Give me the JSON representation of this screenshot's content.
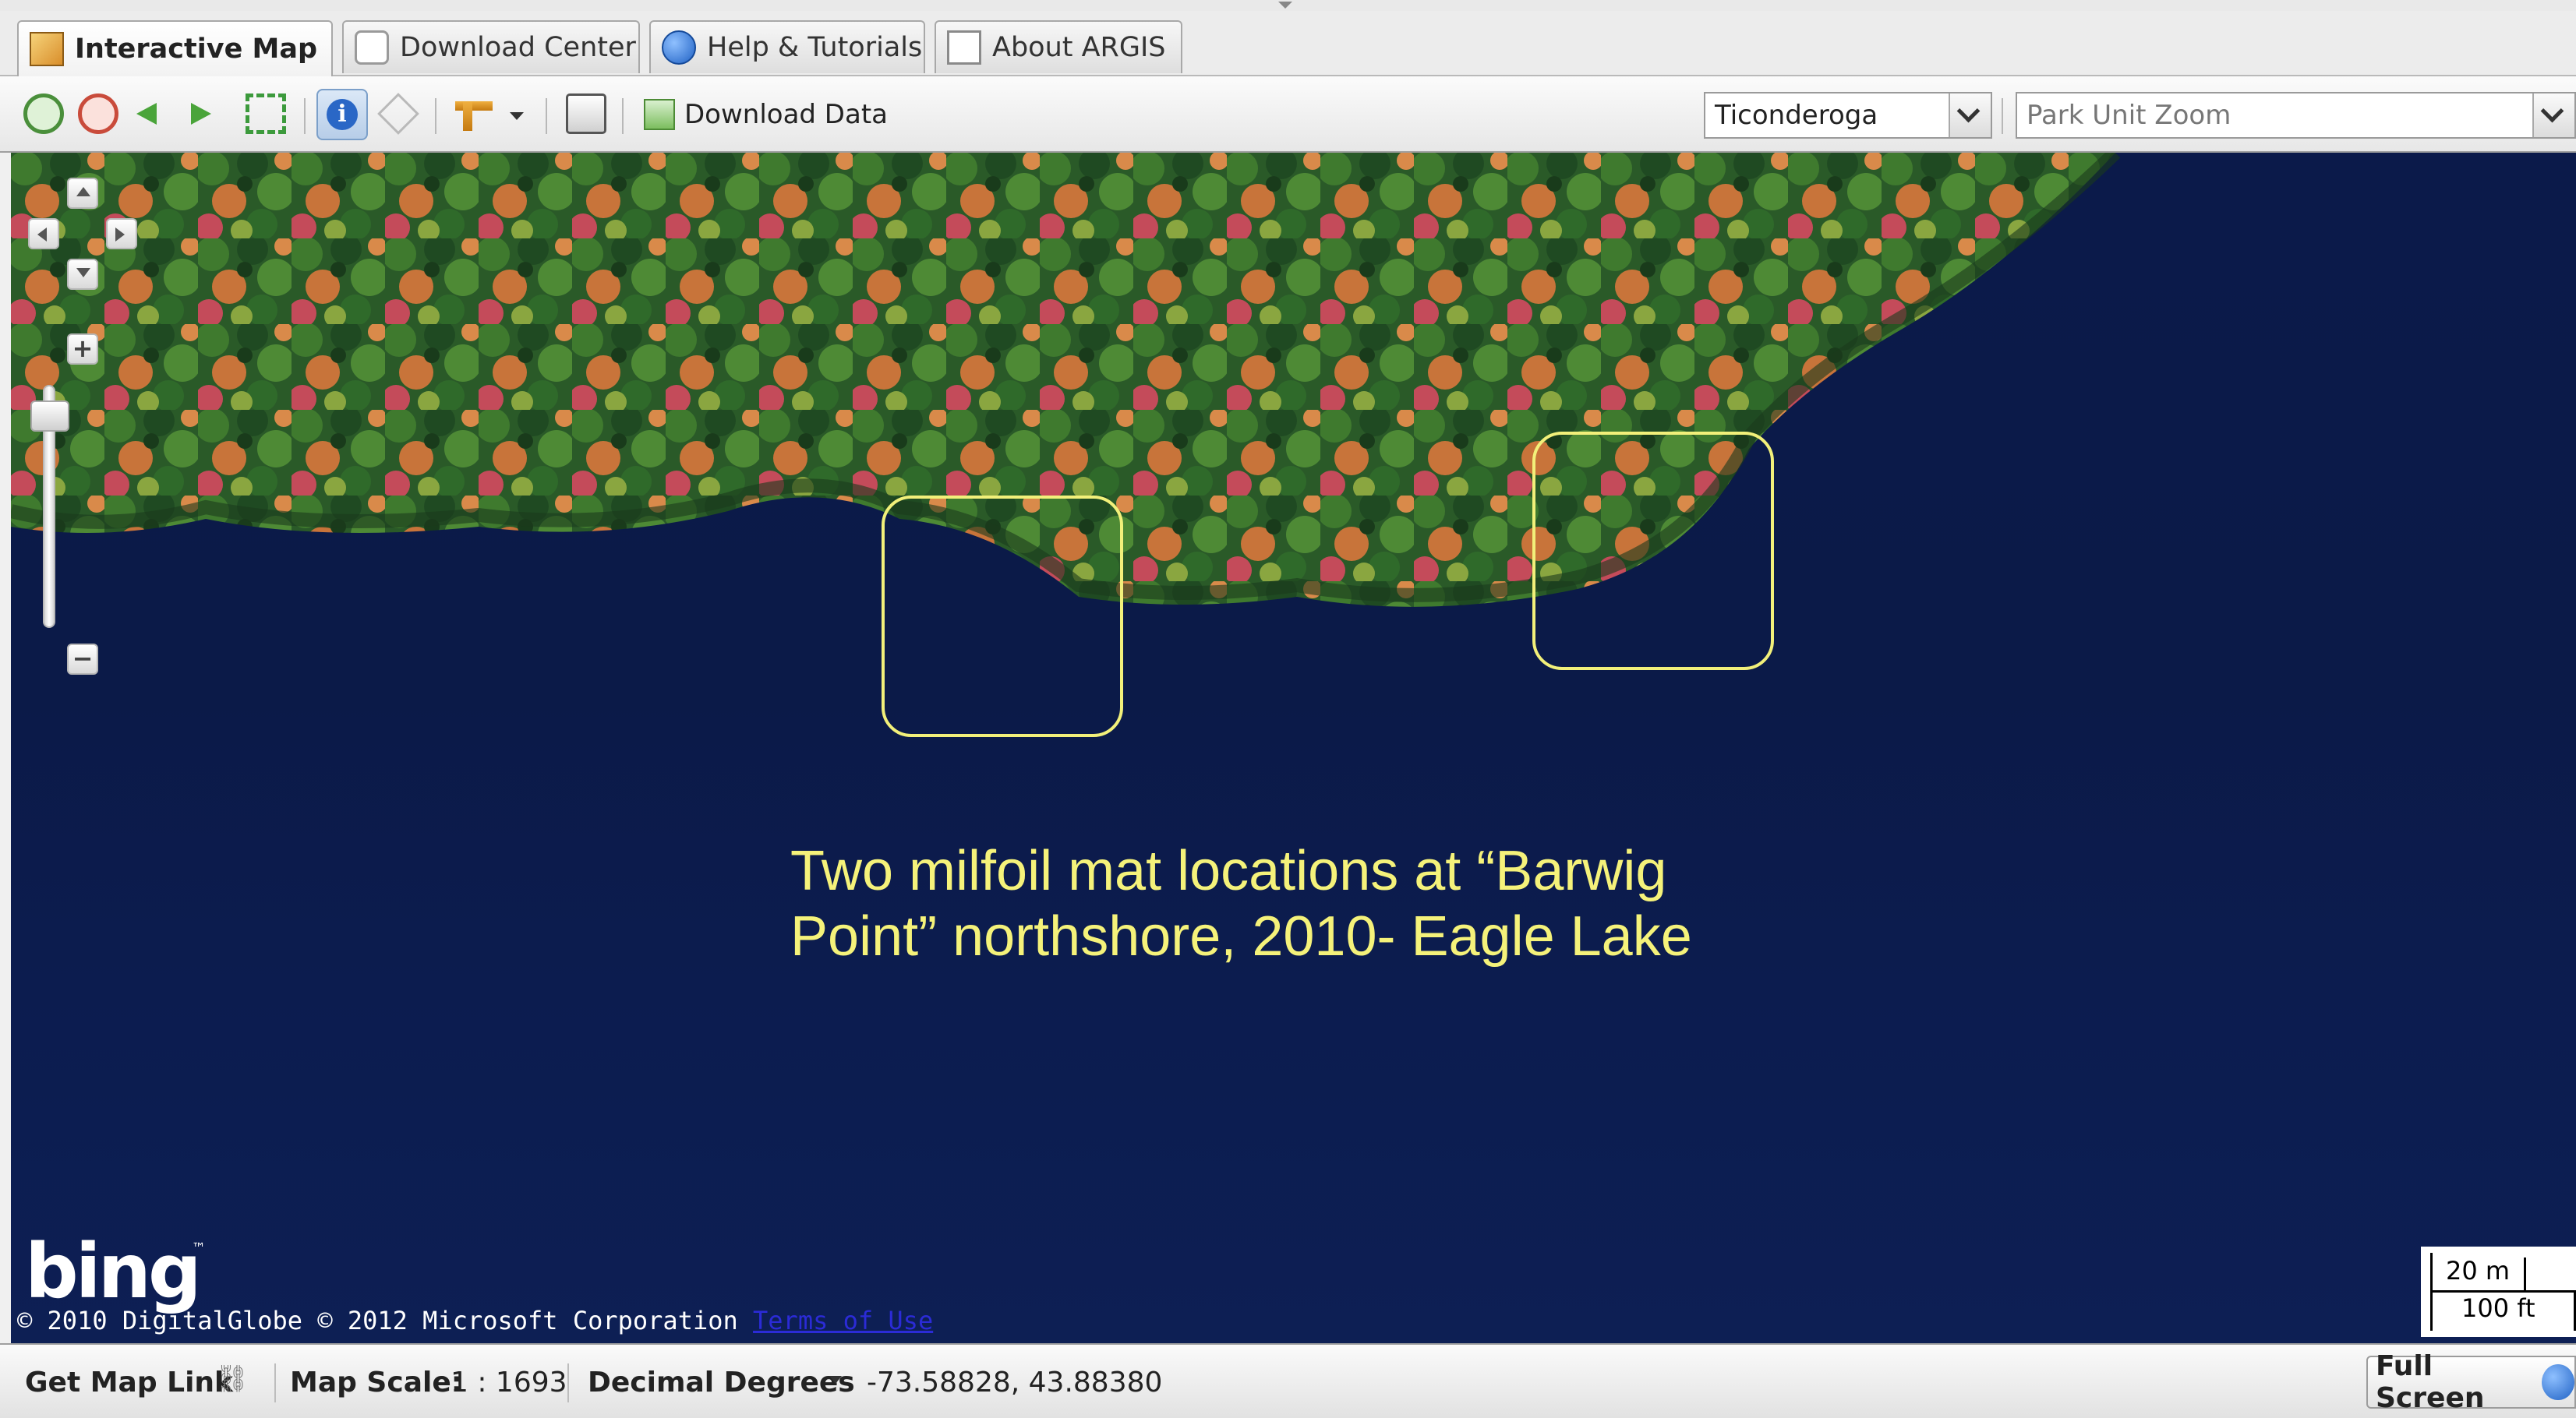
{
  "tabs": [
    {
      "label": "Interactive Map",
      "icon": "map-icon",
      "active": true
    },
    {
      "label": "Download Center",
      "icon": "download-center-icon",
      "active": false
    },
    {
      "label": "Help & Tutorials",
      "icon": "help-icon",
      "active": false
    },
    {
      "label": "About ARGIS",
      "icon": "document-icon",
      "active": false
    }
  ],
  "toolbar": {
    "download_data_label": "Download Data",
    "town_select_value": "Ticonderoga",
    "park_unit_placeholder": "Park Unit Zoom"
  },
  "map": {
    "annotation": "Two milfoil mat locations at “Barwig Point” northshore, 2010- Eagle Lake",
    "logo_text": "bing",
    "logo_tm": "™",
    "copyright": "© 2010 DigitalGlobe © 2012 Microsoft Corporation",
    "terms_link": "Terms of Use",
    "scale_metric": "20 m",
    "scale_imperial": "100 ft",
    "colors": {
      "water": "#0b1a4a",
      "highlight": "#f2f07a"
    }
  },
  "status": {
    "map_link_label": "Get Map Link",
    "scale_label": "Map Scale:",
    "scale_value": "1 : 1693",
    "coord_format": "Decimal Degrees",
    "coordinates": "-73.58828, 43.88380",
    "full_screen_label": "Full Screen"
  }
}
